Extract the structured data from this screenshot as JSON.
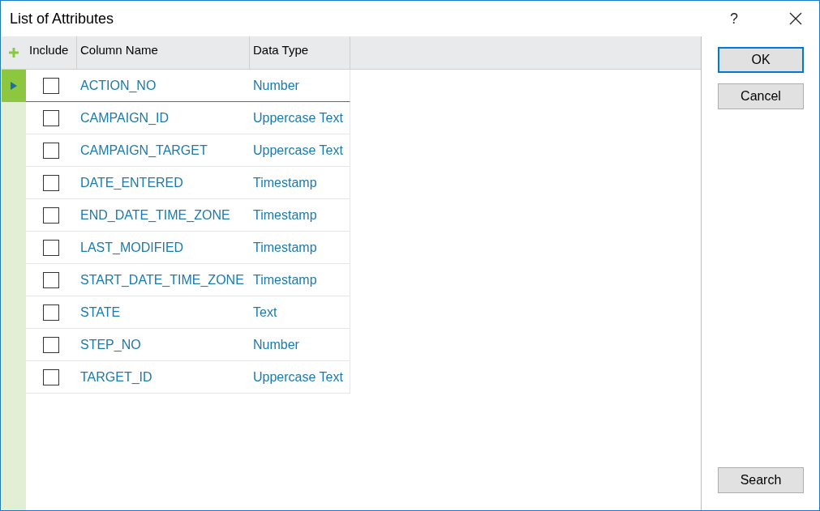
{
  "window": {
    "title": "List of Attributes",
    "help": "?"
  },
  "table": {
    "columns": [
      "Include",
      "Column Name",
      "Data Type"
    ],
    "rows": [
      {
        "name": "ACTION_NO",
        "type": "Number",
        "checked": false,
        "selected": true
      },
      {
        "name": "CAMPAIGN_ID",
        "type": "Uppercase Text",
        "checked": false,
        "selected": false
      },
      {
        "name": "CAMPAIGN_TARGET",
        "type": "Uppercase Text",
        "checked": false,
        "selected": false
      },
      {
        "name": "DATE_ENTERED",
        "type": "Timestamp",
        "checked": false,
        "selected": false
      },
      {
        "name": "END_DATE_TIME_ZONE",
        "type": "Timestamp",
        "checked": false,
        "selected": false
      },
      {
        "name": "LAST_MODIFIED",
        "type": "Timestamp",
        "checked": false,
        "selected": false
      },
      {
        "name": "START_DATE_TIME_ZONE",
        "type": "Timestamp",
        "checked": false,
        "selected": false
      },
      {
        "name": "STATE",
        "type": "Text",
        "checked": false,
        "selected": false
      },
      {
        "name": "STEP_NO",
        "type": "Number",
        "checked": false,
        "selected": false
      },
      {
        "name": "TARGET_ID",
        "type": "Uppercase Text",
        "checked": false,
        "selected": false
      }
    ]
  },
  "buttons": [
    {
      "label": "OK",
      "kind": "default"
    },
    {
      "label": "Cancel",
      "kind": "normal"
    },
    {
      "label": "Search",
      "kind": "bottom"
    }
  ]
}
